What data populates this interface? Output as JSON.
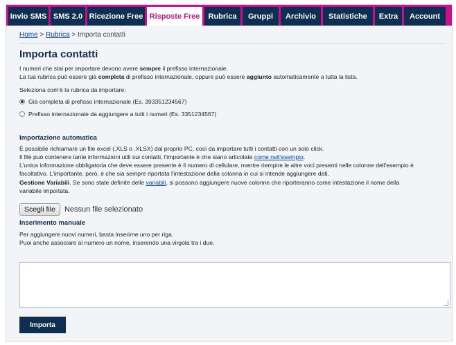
{
  "tabs": [
    {
      "label": "Invio SMS",
      "active": false
    },
    {
      "label": "SMS 2.0",
      "active": false
    },
    {
      "label": "Ricezione Free",
      "active": false
    },
    {
      "label": "Risposte Free",
      "active": true
    },
    {
      "label": "Rubrica",
      "active": false
    },
    {
      "label": "Gruppi",
      "active": false
    },
    {
      "label": "Archivio",
      "active": false
    },
    {
      "label": "Statistiche",
      "active": false
    },
    {
      "label": "Extra",
      "active": false
    },
    {
      "label": "Account",
      "active": false
    }
  ],
  "breadcrumb": {
    "home": "Home",
    "sep1": " > ",
    "rubrica": "Rubrica",
    "sep2": " > ",
    "current": "Importa contatti"
  },
  "page_title": "Importa contatti",
  "intro": {
    "l1_a": "I numeri che stai per importare devono avere ",
    "l1_b": "sempre",
    "l1_c": " il prefisso internazionale.",
    "l2_a": "La tua rubrica può essere già ",
    "l2_b": "completa",
    "l2_c": " di prefisso internazionale, oppure può essere ",
    "l2_d": "aggiunto",
    "l2_e": " automaticamente a tutta la lista.",
    "select_label": "Seleziona com'è la rubrica da importare:"
  },
  "radios": [
    {
      "label": "Già completa di prefisso internazionale (Es. 393351234567)",
      "checked": true
    },
    {
      "label": "Prefisso internazionale da aggiungere a tutti i numeri (Es. 3351234567)",
      "checked": false
    }
  ],
  "auto_import": {
    "title": "Importazione automatica",
    "l1": "È possibile richiamare un file excel (.XLS o .XLSX) dal proprio PC, così da importare tutti i contatti con un solo click.",
    "l2_a": "Il file può contenere tante informazioni utili sui contatti, l'importante è che siano articolate ",
    "l2_link": "come nell'esempio",
    "l2_b": ".",
    "l3": "L'unica informazione obbligatoria che deve essere presente è il numero di cellulare, mentre riempire le altre voci presenti nelle colonne dell'esempio è",
    "l4": "facoltativo. L'importante, però, è che sia sempre riportata l'intestazione della colonna in cui si intende aggiungere dati.",
    "l5_bold": "Gestione Variabili",
    "l5_a": ". Se sono state definite delle ",
    "l5_link": "variabili",
    "l5_b": ", si possono aggiungere nuove colonne che riporteranno come intestazione il nome della",
    "l6": "variabile importata."
  },
  "file_input": {
    "button": "Scegli file",
    "status": "Nessun file selezionato"
  },
  "manual": {
    "title": "Inserimento manuale",
    "l1": "Per aggiungere nuovi numeri, basta inserirne uno per riga.",
    "l2": "Puoi anche associare al numero un nome, inserendo una virgola tra i due.",
    "textarea_value": ""
  },
  "submit_label": "Importa",
  "colors": {
    "tabbar": "#c8118a",
    "tab": "#0f2f52",
    "active_tab_text": "#c8118a",
    "link": "#0645ad"
  }
}
